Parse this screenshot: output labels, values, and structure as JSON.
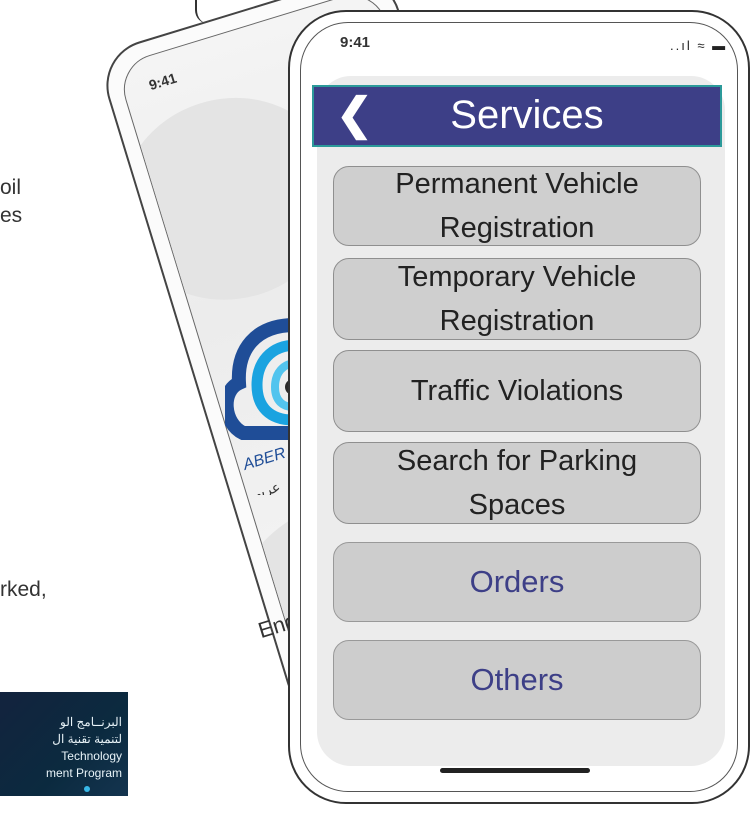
{
  "background_text": {
    "line1": "oil",
    "line2": "es",
    "line3": "rked,"
  },
  "back_phone": {
    "time": "9:41",
    "logo_text": "ABER",
    "arabic_text": "عربي",
    "eng_text": "Eng."
  },
  "front_phone": {
    "time": "9:41",
    "status_icons": "..ıl ≈ ▬"
  },
  "header": {
    "back_icon": "❮",
    "title": "Services"
  },
  "services": [
    {
      "line1": "Permanent Vehicle",
      "line2": "Registration"
    },
    {
      "line1": "Temporary Vehicle",
      "line2": "Registration"
    },
    {
      "line1": "Traffic Violations",
      "line2": ""
    },
    {
      "line1": "Search for Parking",
      "line2": "Spaces"
    },
    {
      "line1": "Orders",
      "line2": ""
    },
    {
      "line1": "Others",
      "line2": ""
    }
  ],
  "banner": {
    "line1": "البرنــامج الو",
    "line2": "لتنمية تقنية ال",
    "line3": "Technology",
    "line4": "ment Program"
  },
  "colors": {
    "header_bg": "#3d3f87",
    "header_border": "#2c9a9a",
    "button_bg": "#cfcfcf",
    "accent_text": "#3d3f87"
  }
}
